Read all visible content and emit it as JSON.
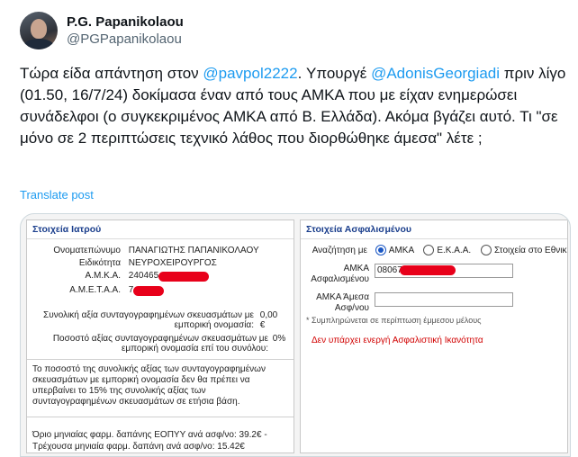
{
  "tweet": {
    "display_name": "P.G. Papanikolaou",
    "handle": "@PGPapanikolaou",
    "text_1": "Τώρα είδα απάντηση στον ",
    "mention_1": "@pavpol2222",
    "text_2": ". Υπουργέ ",
    "mention_2": "@AdonisGeorgiadi",
    "text_3": " πριν λίγο (01.50, 16/7/24) δοκίμασα έναν από τους ΑΜΚΑ που με είχαν ενημερώσει συνάδελφοι (ο συγκεκριμένος ΑΜΚΑ από Β. Ελλάδα). Ακόμα βγάζει αυτό. Τι \"σε μόνο σε 2 περιπτώσεις τεχνικό λάθος που διορθώθηκε άμεσα\" λέτε ;",
    "translate": "Translate post"
  },
  "doctor": {
    "title": "Στοιχεία Ιατρού",
    "name_label": "Ονοματεπώνυμο",
    "name_value": "ΠΑΝΑΓΙΩΤΗΣ ΠΑΠΑΝΙΚΟΛΑΟΥ",
    "specialty_label": "Ειδικότητα",
    "specialty_value": "ΝΕΥΡΟΧΕΙΡΟΥΡΓΟΣ",
    "amka_label": "Α.Μ.Κ.Α.",
    "amka_value": "240465",
    "ametaa_label": "Α.Μ.Ε.Τ.Α.Α.",
    "ametaa_value": "7",
    "total_label_1": "Συνολική αξία συνταγογραφημένων σκευασμάτων με",
    "total_label_2": "εμπορική ονομασία:",
    "total_value": "0,00",
    "total_unit": "€",
    "percent_label_1": "Ποσοστό αξίας συνταγογραφημένων σκευασμάτων με",
    "percent_label_2": "εμπορική ονομασία επί του συνόλου:",
    "percent_value": "0%",
    "info_1": "Το ποσοστό της συνολικής αξίας των συνταγογραφημένων",
    "info_2": "σκευασμάτων με εμπορική ονομασία δεν θα πρέπει να",
    "info_3": "υπερβαίνει το 15% της συνολικής αξίας των",
    "info_4": "συνταγογραφημένων σκευασμάτων σε ετήσια βάση.",
    "limit_1": "Όριο μηνιαίας φαρμ. δαπάνης ΕΟΠΥΥ ανά ασφ/νο: 39.2€ -",
    "limit_2": "Τρέχουσα μηνιαία φαρμ. δαπάνη ανά ασφ/νο: 15.42€"
  },
  "insured": {
    "title": "Στοιχεία Ασφαλισμένου",
    "search_label": "Αναζήτηση με",
    "opt_amka": "ΑΜΚΑ",
    "opt_ekaa": "Ε.Κ.Α.Α.",
    "opt_other": "Στοιχεία στο Εθνικ",
    "amka_label_1": "ΑΜΚΑ",
    "amka_label_2": "Ασφαλισμένου",
    "amka_value": "08067",
    "indirect_label_1": "ΑΜΚΑ Άμεσα",
    "indirect_label_2": "Ασφ/νου",
    "indirect_value": "",
    "note": "* Συμπληρώνεται σε περίπτωση έμμεσου μέλους",
    "error": "Δεν υπάρχει ενεργή Ασφαλιστική Ικανότητα"
  },
  "colors": {
    "link": "#1d9bf0",
    "error": "#d10000",
    "redaction": "#e8001a"
  }
}
